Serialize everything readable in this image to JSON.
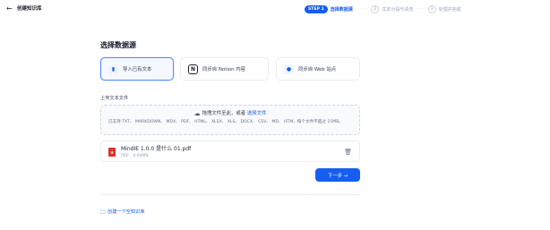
{
  "header": {
    "back_icon": "arrow-left-icon",
    "title": "创建知识库"
  },
  "steps": [
    {
      "badge": "STEP 1",
      "label": "选择数据源",
      "active": true
    },
    {
      "number": "2",
      "label": "文本分段与清洗",
      "active": false
    },
    {
      "number": "3",
      "label": "处理并完成",
      "active": false
    }
  ],
  "main": {
    "heading": "选择数据源",
    "sources": [
      {
        "label": "导入已有文本",
        "icon": "document-icon",
        "active": true
      },
      {
        "label": "同步自 Notion 内容",
        "icon": "notion-icon",
        "active": false
      },
      {
        "label": "同步自 Web 站点",
        "icon": "web-icon",
        "active": false
      }
    ],
    "upload": {
      "label": "上传文本文件",
      "drop_text": "拖拽文件至此，或者",
      "select_link": "选择文件",
      "hint": "已支持 TXT、 MARKDOWN、 MDX、 PDF、 HTML、 XLSX、 XLS、 DOCX、 CSV、 MD、 HTM，每个文件不超过 15MB。"
    },
    "file": {
      "name": "MindIE 1.0.0 是什么 01.pdf",
      "meta": "PDF · 0.64MB",
      "type_icon": "pdf-icon",
      "delete_icon": "trash-icon"
    },
    "next_button": "下一步 →",
    "create_empty": "创建一个空知识库"
  },
  "colors": {
    "accent": "#155eef",
    "pdf": "#e0312d",
    "border": "#eaecf0"
  }
}
